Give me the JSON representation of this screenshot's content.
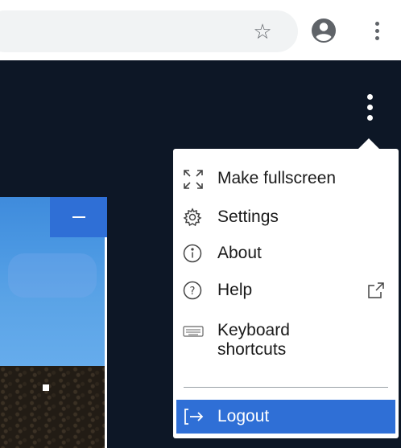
{
  "browser": {
    "star_icon": "☆",
    "account_icon": "account-circle",
    "menu_icon": "kebab"
  },
  "menu": {
    "items": [
      {
        "id": "fullscreen",
        "label": "Make fullscreen",
        "icon": "fullscreen-icon"
      },
      {
        "id": "settings",
        "label": "Settings",
        "icon": "gear-icon"
      },
      {
        "id": "about",
        "label": "About",
        "icon": "info-icon"
      },
      {
        "id": "help",
        "label": "Help",
        "icon": "help-icon",
        "external": true
      },
      {
        "id": "shortcuts",
        "label_line1": "Keyboard",
        "label_line2": "shortcuts",
        "icon": "keyboard-icon"
      }
    ],
    "logout_label": "Logout"
  },
  "colors": {
    "accent": "#2f6fd6",
    "background": "#0d1726",
    "chrome_bg": "#ffffff"
  }
}
